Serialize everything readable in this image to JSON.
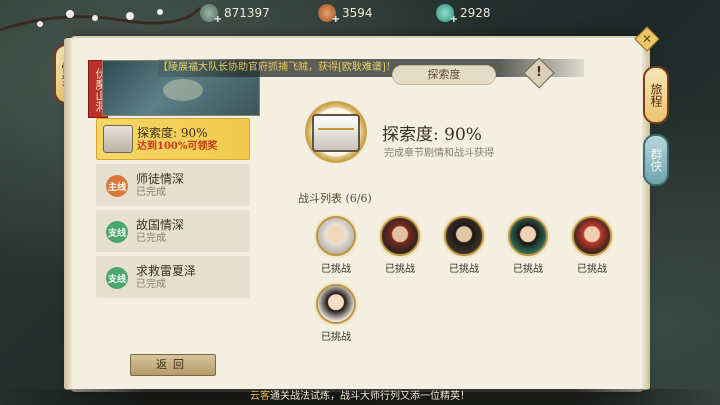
{
  "currencies": [
    {
      "icon": "jade-coin-icon",
      "value": "871397"
    },
    {
      "icon": "copper-coin-icon",
      "value": "3594"
    },
    {
      "icon": "teal-gem-icon",
      "value": "2928"
    }
  ],
  "left_lantern": "忆梦",
  "right_tabs": {
    "journey": "旅程",
    "hero": "群侠"
  },
  "map_label": "伏魔山洞",
  "notice": {
    "prefix": "【",
    "name": "陵展福大队长",
    "text": "协助官府抓捕飞贼，获得",
    "reward": "[欧耿难谱]",
    "suffix": "！"
  },
  "tasks": [
    {
      "type": "chest",
      "title": "探索度: 90%",
      "sub": "达到100%可领奖",
      "active": true
    },
    {
      "type": "main",
      "badge": "主线",
      "title": "师徒情深",
      "sub": "已完成"
    },
    {
      "type": "side",
      "badge": "支线",
      "title": "故国情深",
      "sub": "已完成"
    },
    {
      "type": "side",
      "badge": "支线",
      "title": "求救雷夏泽",
      "sub": "已完成"
    }
  ],
  "section_tag": "探索度",
  "explore": {
    "title": "探索度: 90%",
    "sub": "完成章节剧情和战斗获得",
    "value": 90
  },
  "fight_list_title": "战斗列表 (6/6)",
  "fighters": [
    {
      "status": "已挑战"
    },
    {
      "status": "已挑战"
    },
    {
      "status": "已挑战"
    },
    {
      "status": "已挑战"
    },
    {
      "status": "已挑战"
    },
    {
      "status": "已挑战"
    }
  ],
  "back_button": "返回",
  "ticker": {
    "who": "云客",
    "text": "通关战法试炼，战斗大师行列又添一位精英！"
  }
}
